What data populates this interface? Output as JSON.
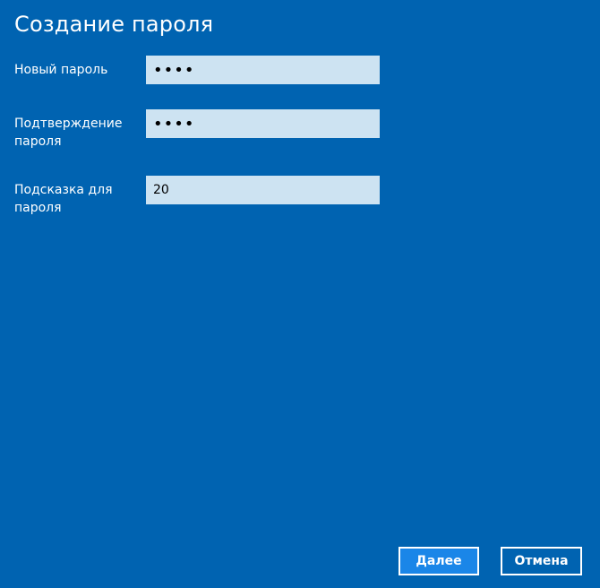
{
  "dialog": {
    "title": "Создание пароля"
  },
  "form": {
    "new_password": {
      "label": "Новый пароль",
      "value": "••••"
    },
    "confirm_password": {
      "label": "Подтверждение пароля",
      "value": "••••"
    },
    "hint": {
      "label": "Подсказка для пароля",
      "value": "20"
    }
  },
  "buttons": {
    "next_label": "Далее",
    "cancel_label": "Отмена"
  },
  "colors": {
    "background": "#0063b1",
    "field_background": "#cde3f2",
    "primary_button": "#1a86e8",
    "text": "#ffffff"
  }
}
